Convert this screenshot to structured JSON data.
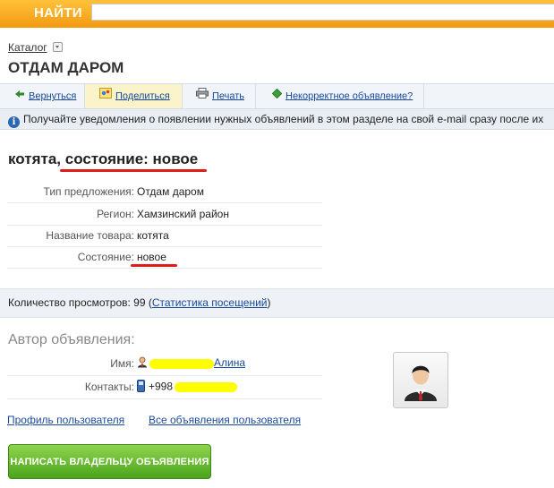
{
  "search": {
    "button_label": "НАЙТИ",
    "value": ""
  },
  "breadcrumb": {
    "label": "Каталог"
  },
  "page_title": "ОТДАМ ДАРОМ",
  "toolbar": {
    "back": "Вернуться",
    "share": "Поделиться",
    "print": "Печать",
    "report": "Некорректное объявление?"
  },
  "info": {
    "text": "Получайте уведомления о появлении нужных объявлений в этом разделе на свой e-mail сразу после их"
  },
  "listing": {
    "title_part1": "котята",
    "title_sep": ", ",
    "title_part2": "состояние: новое",
    "attributes": [
      {
        "label": "Тип предложения:",
        "value": "Отдам даром"
      },
      {
        "label": "Регион:",
        "value": "Хамзинский район"
      },
      {
        "label": "Название товара:",
        "value": "котята"
      },
      {
        "label": "Состояние:",
        "value": "новое"
      }
    ]
  },
  "views": {
    "prefix": "Количество просмотров: 99 (",
    "link": "Статистика посещений",
    "suffix": ")"
  },
  "author": {
    "title": "Автор объявления:",
    "name_label": "Имя:",
    "name_value": "Алина",
    "contacts_label": "Контакты:",
    "contacts_value": "+998"
  },
  "links": {
    "profile": "Профиль пользователя",
    "all_ads": "Все объявления пользователя"
  },
  "write_button": "НАПИСАТЬ ВЛАДЕЛЬЦУ ОБЪЯВЛЕНИЯ",
  "colors": {
    "topbar": "#f39a12",
    "link": "#1a4a9c",
    "highlight_red": "#e11a1a",
    "highlight_yellow": "#ffff00",
    "button_green": "#4aa51b"
  }
}
